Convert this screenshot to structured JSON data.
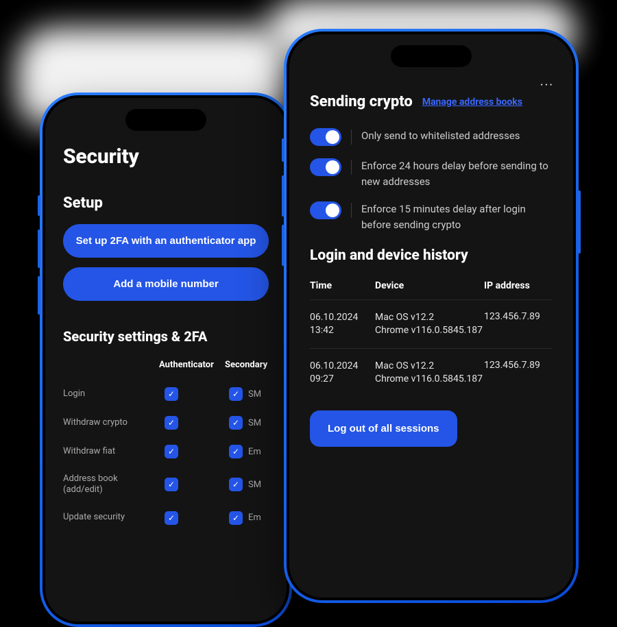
{
  "left": {
    "title": "Security",
    "setup": {
      "heading": "Setup",
      "btn_2fa": "Set up 2FA with an authenticator app",
      "btn_mobile": "Add a mobile number"
    },
    "settings": {
      "heading": "Security settings & 2FA",
      "col_auth": "Authenticator",
      "col_secondary": "Secondary",
      "rows": [
        {
          "label": "Login",
          "secondary": "SM"
        },
        {
          "label": "Withdraw crypto",
          "secondary": "SM"
        },
        {
          "label": "Withdraw fiat",
          "secondary": "Em"
        },
        {
          "label": "Address book (add/edit)",
          "secondary": "SM"
        },
        {
          "label": "Update security",
          "secondary": "Em"
        }
      ]
    }
  },
  "right": {
    "more": "···",
    "sending": {
      "title": "Sending crypto",
      "manage_link": "Manage address books",
      "toggles": [
        "Only send to whitelisted addresses",
        "Enforce 24 hours delay before sending to new addresses",
        "Enforce 15 minutes delay after login before sending crypto"
      ]
    },
    "history": {
      "title": "Login and device history",
      "col_time": "Time",
      "col_device": "Device",
      "col_ip": "IP address",
      "rows": [
        {
          "date": "06.10.2024",
          "time": "13:42",
          "os": "Mac OS v12.2",
          "browser": "Chrome v116.0.5845.187",
          "ip": "123.456.7.89"
        },
        {
          "date": "06.10.2024",
          "time": "09:27",
          "os": "Mac OS v12.2",
          "browser": "Chrome v116.0.5845.187",
          "ip": "123.456.7.89"
        }
      ],
      "logout_btn": "Log out of all sessions"
    }
  }
}
